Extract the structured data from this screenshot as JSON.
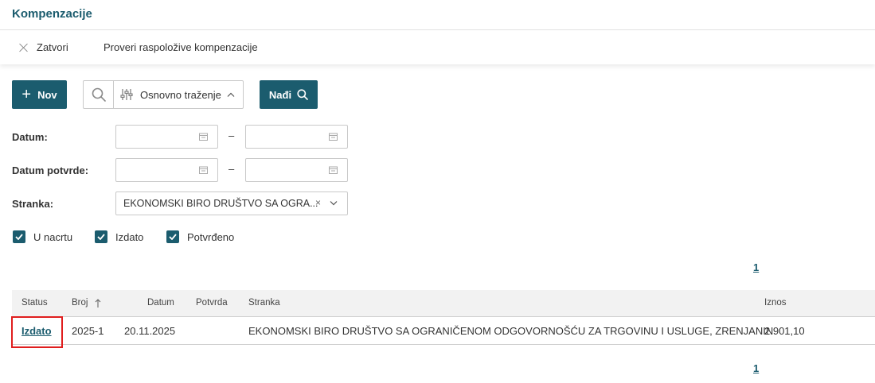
{
  "header": {
    "title": "Kompenzacije"
  },
  "toolbar": {
    "close_label": "Zatvori",
    "check_label": "Proveri raspoložive kompenzacije"
  },
  "actions": {
    "new_label": "Nov",
    "search_mode_label": "Osnovno traženje",
    "find_label": "Nađi"
  },
  "filters": {
    "datum_label": "Datum:",
    "datum_from": "",
    "datum_to": "",
    "potvrda_label": "Datum potvrde:",
    "potvrda_from": "",
    "potvrda_to": "",
    "range_separator": "–",
    "stranka_label": "Stranka:",
    "stranka_value": "EKONOMSKI BIRO DRUŠTVO SA OGRA...",
    "stranka_clear": "×",
    "status_checkboxes": [
      {
        "label": "U nacrtu",
        "checked": true
      },
      {
        "label": "Izdato",
        "checked": true
      },
      {
        "label": "Potvrđeno",
        "checked": true
      }
    ]
  },
  "pagination": {
    "current_page": "1"
  },
  "table": {
    "columns": {
      "status": "Status",
      "broj": "Broj",
      "datum": "Datum",
      "potvrda": "Potvrda",
      "stranka": "Stranka",
      "iznos": "Iznos"
    },
    "sort": {
      "column": "broj",
      "direction": "ascending"
    },
    "rows": [
      {
        "status": "Izdato",
        "broj": "2025-1",
        "datum": "20.11.2025",
        "potvrda": "",
        "stranka": "EKONOMSKI BIRO DRUŠTVO SA OGRANIČENOM ODGOVORNOŠĆU ZA TRGOVINU I USLUGE, ZRENJANIN",
        "iznos": "2.901,10"
      }
    ]
  },
  "colors": {
    "accent": "#1b5c6e",
    "highlight": "#e01e1e",
    "table_header_bg": "#f2f2f2"
  },
  "icons": {
    "close": "close-icon",
    "new": "plus-icon",
    "search": "search-icon",
    "filter": "sliders-icon",
    "calendar": "calendar-icon",
    "dropdown": "chevron-down-icon",
    "sort": "arrow-up-icon",
    "checkbox": "checkmark-icon"
  }
}
